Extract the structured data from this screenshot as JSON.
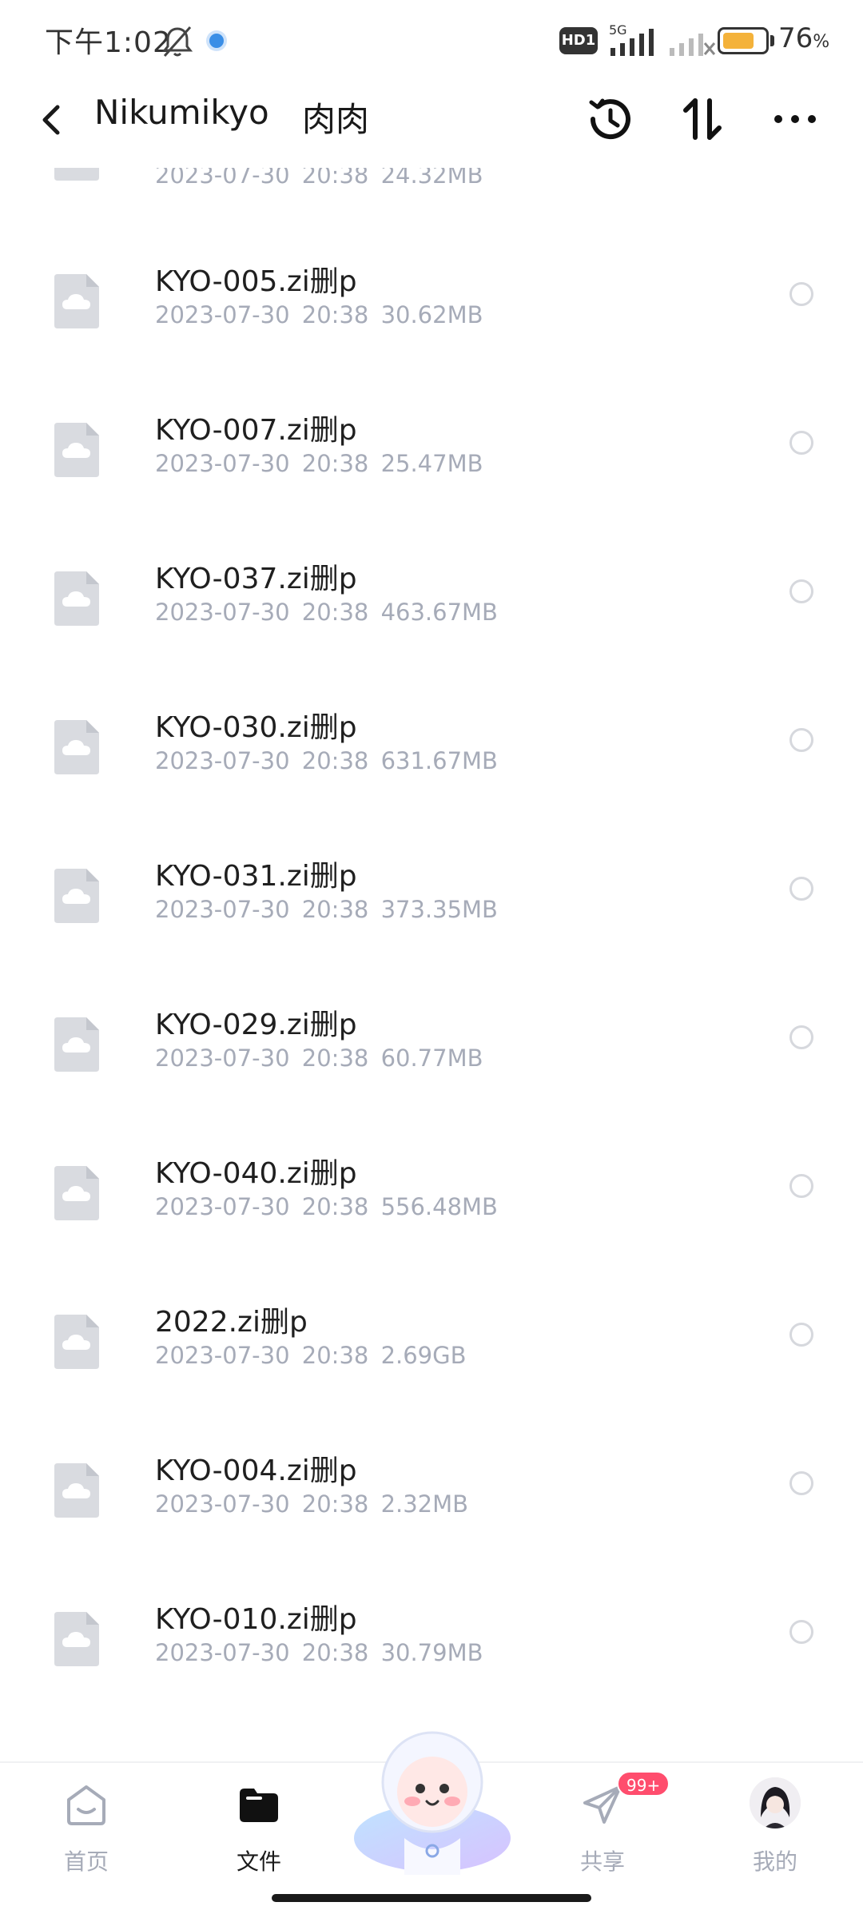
{
  "status_bar": {
    "time": "下午1:02",
    "hd_label": "HD1",
    "network_label": "5G",
    "battery_percent": "76",
    "battery_unit": "%",
    "battery_level": 0.76
  },
  "header": {
    "title": "Nikumikyo",
    "subtitle": "肉肉"
  },
  "files": [
    {
      "name": "",
      "date": "2023-07-30",
      "time": "20:38",
      "size": "24.32MB"
    },
    {
      "name": "KYO-005.zi删p",
      "date": "2023-07-30",
      "time": "20:38",
      "size": "30.62MB"
    },
    {
      "name": "KYO-007.zi删p",
      "date": "2023-07-30",
      "time": "20:38",
      "size": "25.47MB"
    },
    {
      "name": "KYO-037.zi删p",
      "date": "2023-07-30",
      "time": "20:38",
      "size": "463.67MB"
    },
    {
      "name": "KYO-030.zi删p",
      "date": "2023-07-30",
      "time": "20:38",
      "size": "631.67MB"
    },
    {
      "name": "KYO-031.zi删p",
      "date": "2023-07-30",
      "time": "20:38",
      "size": "373.35MB"
    },
    {
      "name": "KYO-029.zi删p",
      "date": "2023-07-30",
      "time": "20:38",
      "size": "60.77MB"
    },
    {
      "name": "KYO-040.zi删p",
      "date": "2023-07-30",
      "time": "20:38",
      "size": "556.48MB"
    },
    {
      "name": "2022.zi删p",
      "date": "2023-07-30",
      "time": "20:38",
      "size": "2.69GB"
    },
    {
      "name": "KYO-004.zi删p",
      "date": "2023-07-30",
      "time": "20:38",
      "size": "2.32MB"
    },
    {
      "name": "KYO-010.zi删p",
      "date": "2023-07-30",
      "time": "20:38",
      "size": "30.79MB"
    }
  ],
  "bottom_nav": {
    "home": "首页",
    "files": "文件",
    "share": "共享",
    "share_badge": "99+",
    "me": "我的"
  },
  "icons": {
    "back": "chevron-left-icon",
    "history": "history-icon",
    "sort": "sort-icon",
    "more": "more-horizontal-icon",
    "file": "cloud-file-icon"
  },
  "colors": {
    "accent_badge": "#ff4d6d",
    "battery": "#f4b23a",
    "meta_text": "#a6abb8"
  }
}
